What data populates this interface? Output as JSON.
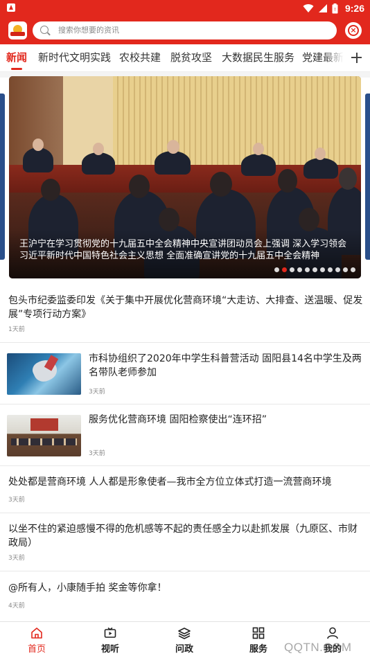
{
  "status_bar": {
    "time": "9:26",
    "icons": [
      "app-badge-icon",
      "wifi-icon",
      "signal-icon",
      "battery-icon"
    ]
  },
  "header": {
    "search_placeholder": "搜索你想要的资讯",
    "accent_color": "#e2281d"
  },
  "tabs": {
    "items": [
      "新闻",
      "新时代文明实践",
      "农校共建",
      "脱贫攻坚",
      "大数据民生服务",
      "党建最新热"
    ],
    "active_index": 0
  },
  "banner": {
    "caption": "王沪宁在学习贯彻党的十九届五中全会精神中央宣讲团动员会上强调  深入学习领会习近平新时代中国特色社会主义思想  全面准确宣讲党的十九届五中全会精神",
    "slide_count": 11,
    "active_slide": 1
  },
  "news": [
    {
      "title": "包头市纪委监委印发《关于集中开展优化营商环境“大走访、大排查、送温暖、促发展”专项行动方案》",
      "time": "1天前",
      "thumbnail": false
    },
    {
      "title": "市科协组织了2020年中学生科普营活动  固阳县14名中学生及两名带队老师参加",
      "time": "3天前",
      "thumbnail": true
    },
    {
      "title": "服务优化营商环境  固阳检察使出“连环招”",
      "time": "3天前",
      "thumbnail": true
    },
    {
      "title": "处处都是营商环境  人人都是形象使者—我市全方位立体式打造一流营商环境",
      "time": "3天前",
      "thumbnail": false
    },
    {
      "title": "以坐不住的紧迫感慢不得的危机感等不起的责任感全力以赴抓发展（九原区、市财政局）",
      "time": "3天前",
      "thumbnail": false
    },
    {
      "title": "@所有人，小康随手拍  奖金等你拿！",
      "time": "4天前",
      "thumbnail": false
    }
  ],
  "bottom_nav": {
    "items": [
      {
        "label": "首页",
        "icon": "home-icon"
      },
      {
        "label": "视听",
        "icon": "video-icon"
      },
      {
        "label": "问政",
        "icon": "layers-icon"
      },
      {
        "label": "服务",
        "icon": "grid-icon"
      },
      {
        "label": "我的",
        "icon": "user-icon"
      }
    ],
    "active_index": 0
  },
  "watermark": "QQTN.COM"
}
